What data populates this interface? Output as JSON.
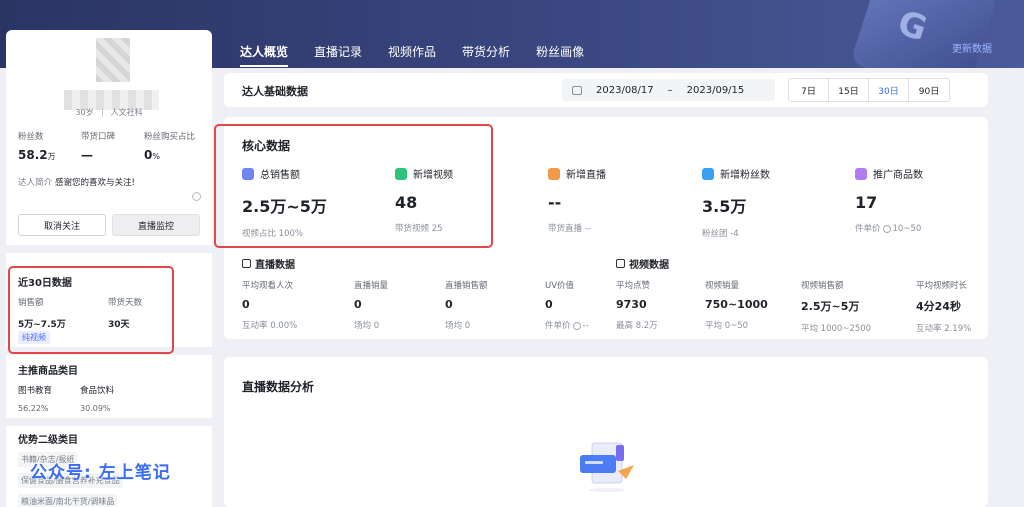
{
  "header": {
    "tabs": [
      "达人概览",
      "直播记录",
      "视频作品",
      "带货分析",
      "粉丝画像"
    ],
    "refresh": "更新数据",
    "deco_text": "G"
  },
  "profile": {
    "age": "30岁",
    "category": "人文社科",
    "stats": [
      {
        "label": "粉丝数",
        "value": "58.2",
        "unit": "万"
      },
      {
        "label": "带货口碑",
        "value": "—",
        "unit": ""
      },
      {
        "label": "粉丝购买占比",
        "value": "0",
        "unit": "%"
      }
    ],
    "intro_label": "达人简介",
    "intro_text": "感谢您的喜欢与关注!",
    "unfollow": "取消关注",
    "live_monitor": "直播监控"
  },
  "recent30": {
    "title": "近30日数据",
    "sales_label": "销售额",
    "sales_value": "5万~7.5万",
    "days_label": "带货天数",
    "days_value": "30天",
    "tag": "纯视频"
  },
  "main_categories": {
    "title": "主推商品类目",
    "items": [
      {
        "name": "图书教育",
        "pct": "56.22%"
      },
      {
        "name": "食品饮料",
        "pct": "30.09%"
      }
    ]
  },
  "secondary": {
    "title": "优势二级类目",
    "chips": [
      "书籍/杂志/报纸",
      "保健食品/膳食营养补充食品",
      "粮油米面/南北干货/调味品"
    ]
  },
  "watermark": "公众号: 左上笔记",
  "basic": {
    "title": "达人基础数据",
    "date_start": "2023/08/17",
    "date_sep": "–",
    "date_end": "2023/09/15",
    "ranges": [
      "7日",
      "15日",
      "30日",
      "90日"
    ]
  },
  "core": {
    "title": "核心数据",
    "metrics": [
      {
        "label": "总销售额",
        "value": "2.5万~5万",
        "sub": "视频占比 100%",
        "color": "#6f86f0"
      },
      {
        "label": "新增视频",
        "value": "48",
        "sub": "带货视频 25",
        "color": "#2fc27a"
      },
      {
        "label": "新增直播",
        "value": "--",
        "sub": "带货直播 --",
        "color": "#f2994a"
      },
      {
        "label": "新增粉丝数",
        "value": "3.5万",
        "sub": "粉丝团 -4",
        "color": "#3aa0f5"
      },
      {
        "label": "推广商品数",
        "value": "17",
        "sub": "件单价",
        "sub2": "10~50",
        "color": "#b07cf0"
      }
    ]
  },
  "live": {
    "title": "直播数据",
    "cols": [
      {
        "label": "平均观看人次",
        "value": "0",
        "sub": "互动率 0.00%"
      },
      {
        "label": "直播销量",
        "value": "0",
        "sub": "场均 0"
      },
      {
        "label": "直播销售额",
        "value": "0",
        "sub": "场均 0"
      },
      {
        "label": "UV价值",
        "value": "0",
        "sub": "件单价",
        "sub2": "--"
      }
    ]
  },
  "video": {
    "title": "视频数据",
    "cols": [
      {
        "label": "平均点赞",
        "value": "9730",
        "sub": "最高 8.2万"
      },
      {
        "label": "视频销量",
        "value": "750~1000",
        "sub": "平均 0~50"
      },
      {
        "label": "视频销售额",
        "value": "2.5万~5万",
        "sub": "平均 1000~2500"
      },
      {
        "label": "平均视频时长",
        "value": "4分24秒",
        "sub": "互动率 2.19%"
      }
    ]
  },
  "live_analysis": {
    "title": "直播数据分析"
  }
}
